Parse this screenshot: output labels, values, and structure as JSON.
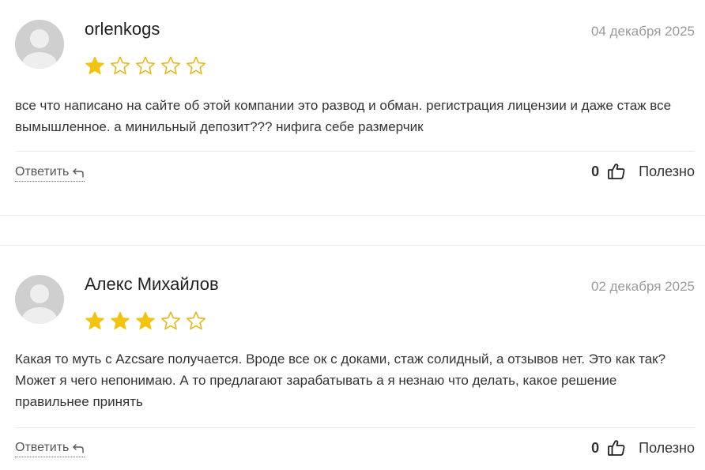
{
  "colors": {
    "star_filled": "#f1c40f",
    "star_outline": "#e3b81c",
    "date_text": "#9a9a9a",
    "divider": "#ebebeb"
  },
  "reviews": [
    {
      "author": "orlenkogs",
      "date": "04 декабря 2025",
      "rating": 1,
      "max_rating": 5,
      "text": "все что написано на сайте об этой компании это развод и обман. регистрация лицензии и даже стаж все вымышленное. а минильный депозит??? нифига себе размерчик",
      "reply_label": "Ответить",
      "helpful_count": "0",
      "helpful_label": "Полезно",
      "avatar_icon": "user-silhouette-icon",
      "reply_icon": "reply-arrow-icon",
      "helpful_icon": "thumbs-up-icon"
    },
    {
      "author": "Алекс Михайлов",
      "date": "02 декабря 2025",
      "rating": 3,
      "max_rating": 5,
      "text": "Какая то муть с Azcsare получается. Вроде все ок с доками, стаж солидный, а отзывов нет. Это как так? Может я чего непонимаю. А то предлагают зарабатывать а я незнаю что делать, какое решение правильнее принять",
      "reply_label": "Ответить",
      "helpful_count": "0",
      "helpful_label": "Полезно",
      "avatar_icon": "user-silhouette-icon",
      "reply_icon": "reply-arrow-icon",
      "helpful_icon": "thumbs-up-icon"
    }
  ]
}
